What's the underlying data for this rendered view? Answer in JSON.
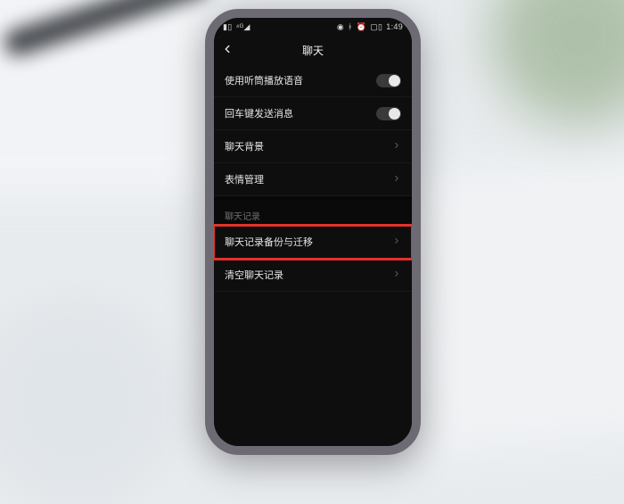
{
  "status": {
    "left_signal": "▮▯",
    "left_network": "⁴ᴳ◢",
    "eye": "◉",
    "bt": "ᚼ",
    "alarm": "⏰",
    "battery": "▢▯",
    "time": "1:49"
  },
  "header": {
    "title": "聊天"
  },
  "rows": {
    "earpiece": {
      "label": "使用听筒播放语音"
    },
    "enter_send": {
      "label": "回车键发送消息"
    },
    "chat_bg": {
      "label": "聊天背景"
    },
    "sticker_mgmt": {
      "label": "表情管理"
    }
  },
  "section": {
    "chat_log": "聊天记录"
  },
  "rows2": {
    "backup_migrate": {
      "label": "聊天记录备份与迁移"
    },
    "clear_log": {
      "label": "清空聊天记录"
    }
  },
  "colors": {
    "highlight": "#e4312b",
    "screen_bg": "#0e0e0e",
    "frame": "#6d6a74"
  }
}
